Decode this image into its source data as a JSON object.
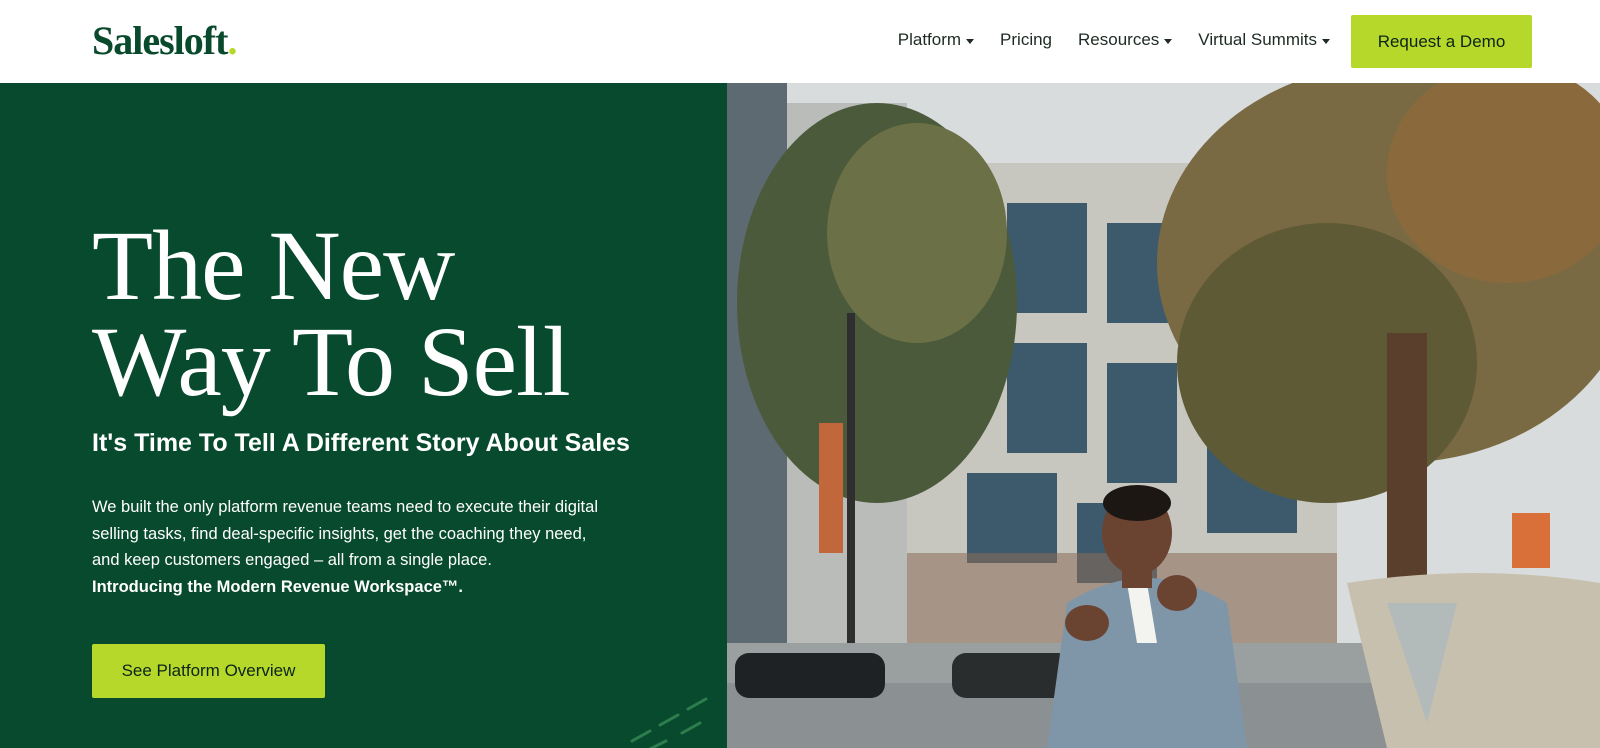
{
  "header": {
    "logo_text": "Salesloft",
    "logo_dot": ".",
    "nav": [
      {
        "label": "Platform",
        "has_dropdown": true
      },
      {
        "label": "Pricing",
        "has_dropdown": false
      },
      {
        "label": "Resources",
        "has_dropdown": true
      },
      {
        "label": "Virtual Summits",
        "has_dropdown": true
      }
    ],
    "cta_label": "Request a Demo"
  },
  "hero": {
    "headline_line1": "The New",
    "headline_line2": "Way To Sell",
    "subheadline": "It's Time To Tell A Different Story About Sales",
    "body": "We built the only platform revenue teams need to execute their digital selling tasks, find deal-specific insights, get the coaching they need, and keep customers engaged – all from a single place.",
    "body_strong": "Introducing the Modern Revenue Workspace™.",
    "button_label": "See Platform Overview"
  },
  "colors": {
    "brand_green": "#084a2e",
    "accent_lime": "#b6d82b",
    "nav_text": "#1d2b22"
  },
  "icons": [
    "chevron-down-icon"
  ]
}
